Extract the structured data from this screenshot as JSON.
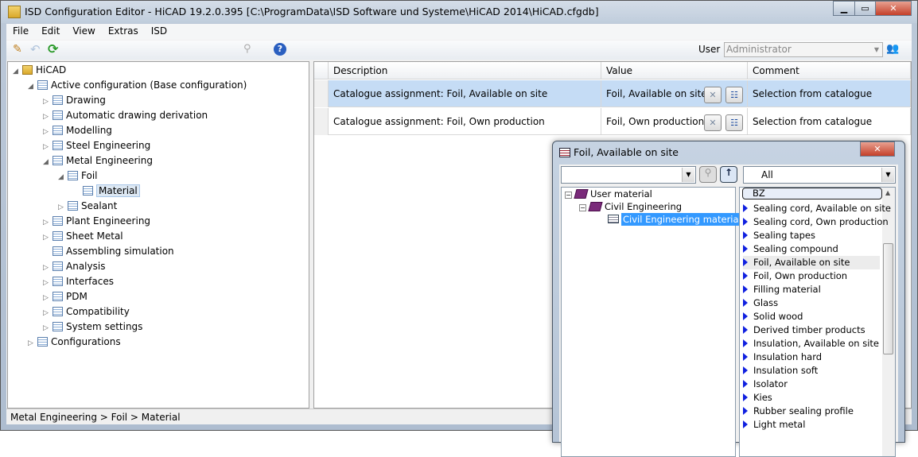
{
  "window": {
    "title": "ISD Configuration Editor  - HiCAD 19.2.0.395 [C:\\ProgramData\\ISD Software und Systeme\\HiCAD 2014\\HiCAD.cfgdb]"
  },
  "menu": [
    "File",
    "Edit",
    "View",
    "Extras",
    "ISD"
  ],
  "toolbar": {
    "user_label": "User",
    "user_value": "Administrator"
  },
  "tree": [
    {
      "label": "HiCAD",
      "level": 0,
      "arrow": "◢"
    },
    {
      "label": "Active configuration (Base configuration)",
      "level": 1,
      "arrow": "◢"
    },
    {
      "label": "Drawing",
      "level": 2,
      "arrow": "▷"
    },
    {
      "label": "Automatic drawing derivation",
      "level": 2,
      "arrow": "▷"
    },
    {
      "label": "Modelling",
      "level": 2,
      "arrow": "▷"
    },
    {
      "label": "Steel Engineering",
      "level": 2,
      "arrow": "▷"
    },
    {
      "label": "Metal Engineering",
      "level": 2,
      "arrow": "◢"
    },
    {
      "label": "Foil",
      "level": 3,
      "arrow": "◢"
    },
    {
      "label": "Material",
      "level": 4,
      "arrow": "",
      "selected": true
    },
    {
      "label": "Sealant",
      "level": 3,
      "arrow": "▷"
    },
    {
      "label": "Plant Engineering",
      "level": 2,
      "arrow": "▷"
    },
    {
      "label": "Sheet Metal",
      "level": 2,
      "arrow": "▷"
    },
    {
      "label": "Assembling simulation",
      "level": 2,
      "arrow": ""
    },
    {
      "label": "Analysis",
      "level": 2,
      "arrow": "▷"
    },
    {
      "label": "Interfaces",
      "level": 2,
      "arrow": "▷"
    },
    {
      "label": "PDM",
      "level": 2,
      "arrow": "▷"
    },
    {
      "label": "Compatibility",
      "level": 2,
      "arrow": "▷"
    },
    {
      "label": "System settings",
      "level": 2,
      "arrow": "▷"
    },
    {
      "label": "Configurations",
      "level": 1,
      "arrow": "▷"
    }
  ],
  "grid": {
    "headers": [
      "Description",
      "Value",
      "Comment"
    ],
    "rows": [
      {
        "description": "Catalogue assignment: Foil, Available on site",
        "value": "Foil, Available on site",
        "comment": "Selection from catalogue",
        "selected": true
      },
      {
        "description": "Catalogue assignment: Foil, Own production",
        "value": "Foil, Own production",
        "comment": "Selection from catalogue"
      }
    ]
  },
  "status": "Metal Engineering > Foil > Material",
  "dialog": {
    "title": "Foil, Available on site",
    "filter": "All",
    "search": "BZ",
    "tree": [
      "User material",
      "Civil Engineering",
      "Civil Engineering materials"
    ],
    "items": [
      "Sealing cord, Available on site",
      "Sealing cord, Own production",
      "Sealing tapes",
      "Sealing compound",
      "Foil, Available on site",
      "Foil, Own production",
      "Filling material",
      "Glass",
      "Solid wood",
      "Derived timber products",
      "Insulation, Available on site",
      "Insulation hard",
      "Insulation soft",
      "Isolator",
      "Kies",
      "Rubber sealing profile",
      "Light metal"
    ],
    "selected_item": 4
  },
  "colors": {
    "selection": "#c5dcf5",
    "tree_select": "#3399ff"
  }
}
